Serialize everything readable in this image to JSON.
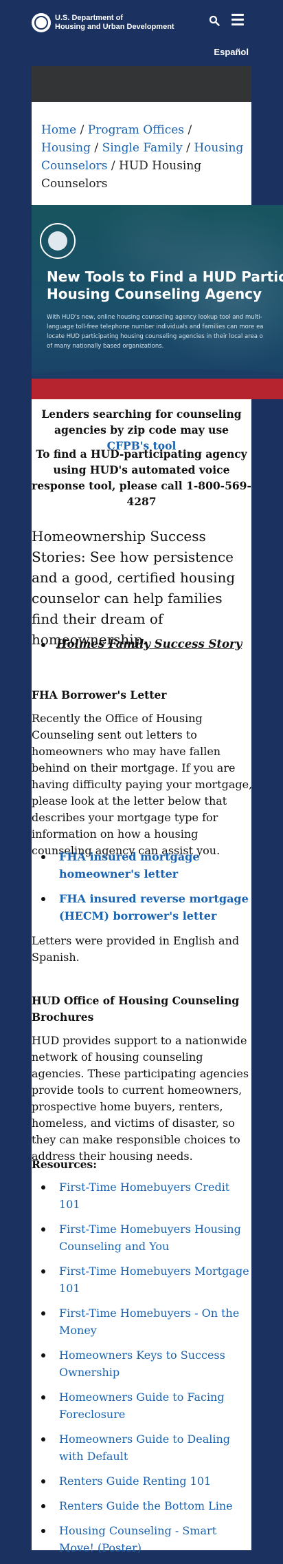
{
  "header": {
    "agency_line1": "U.S. Department of",
    "agency_line2": "Housing and Urban Development",
    "language_link": "Español",
    "icons": [
      "hud-seal-icon",
      "search-icon",
      "menu-icon"
    ]
  },
  "breadcrumb": {
    "items": [
      "Home",
      "Program Offices",
      "Housing",
      "Single Family",
      "Housing Counselors"
    ],
    "current": "HUD Housing Counselors",
    "separator": "/"
  },
  "banner": {
    "title_line1": "New Tools to Find a HUD Particip",
    "title_line2": "Housing Counseling Agency",
    "text_line1": "With HUD's new, online housing counseling agency lookup tool and multi-",
    "text_line2": "language toll-free telephone number individuals and families can more ea",
    "text_line3": "locate HUD participating housing counseling agencies in their local area o",
    "text_line4": "of many nationally based organizations."
  },
  "notices": {
    "lenders_text": "Lenders searching for counseling agencies by zip code may use ",
    "lenders_link": "CFPB's tool",
    "phone_text": "To find a HUD-participating agency using HUD's automated voice response tool, please call 1-800-569-4287"
  },
  "success": {
    "lead": "Homeownership Success Stories:  See how persistence and a good, certified housing counselor can help families find their dream of homeownership.",
    "story_link": "Holmes Family Success Story"
  },
  "fha": {
    "heading": "FHA Borrower's Letter",
    "body": "Recently the Office of Housing Counseling sent out letters to homeowners who may have fallen behind on their mortgage. If you are having difficulty paying your mortgage, please look at the letter below that describes your mortgage type for information on how a housing counseling agency can assist you.",
    "links": [
      "FHA insured mortgage homeowner's letter",
      "FHA insured reverse mortgage (HECM) borrower's letter"
    ],
    "note": "Letters were provided in English and Spanish."
  },
  "brochures": {
    "heading": "HUD Office of Housing Counseling Brochures",
    "body": "HUD provides support to a nationwide network of housing counseling agencies. These participating agencies provide tools to current homeowners, prospective home buyers, renters, homeless, and victims of disaster, so they can make responsible choices to address their housing needs.",
    "resources_label": "Resources:",
    "resources": [
      "First-Time Homebuyers Credit 101",
      "First-Time Homebuyers Housing Counseling and You",
      "First-Time Homebuyers Mortgage 101",
      "First-Time Homebuyers - On the Money",
      "Homeowners Keys to Success Ownership",
      "Homeowners Guide to Facing Foreclosure",
      "Homeowners Guide to Dealing with Default",
      "Renters Guide Renting 101",
      "Renters Guide the Bottom Line",
      "Housing Counseling - Smart Move! (Poster)"
    ]
  }
}
